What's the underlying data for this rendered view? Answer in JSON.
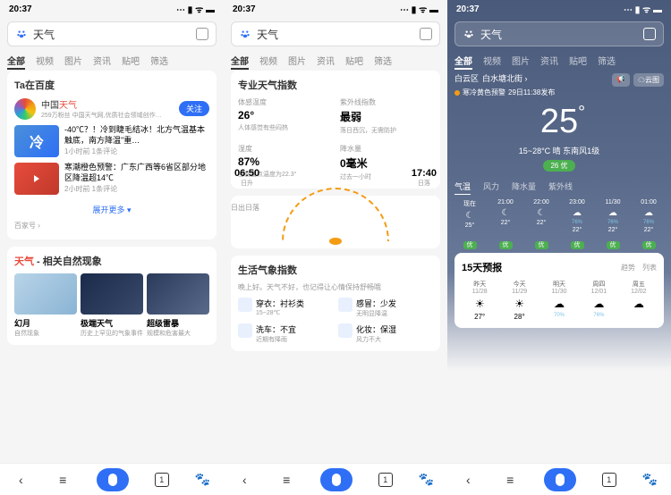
{
  "statusTime": "20:37",
  "searchText": "天气",
  "tabs": [
    "全部",
    "视频",
    "图片",
    "资讯",
    "贴吧",
    "筛选"
  ],
  "s1": {
    "taTitle": "Ta在百度",
    "brandName": "中国天气",
    "brandDesc": "259万粉丝 中国天气网,优质社会领域创作…",
    "followBtn": "关注",
    "news1Title": "-40℃？！冷到睫毛结冰！北方气温基本触底，南方降温\"重…",
    "news1Meta": "1小时前 1条评论",
    "coldChar": "冷",
    "news2Title": "寒潮橙色预警：广东广西等6省区部分地区降温超14℃",
    "news2Meta": "2小时前 1条评论",
    "expand": "展开更多 ▾",
    "source": "百家号 ›",
    "redTitle": "天气",
    "subTitle": " - 相关自然现象",
    "p1Name": "幻月",
    "p1Desc": "自然现象",
    "p2Name": "极端天气",
    "p2Desc": "历史上罕见的气象事件",
    "p3Name": "超级雷暴",
    "p3Desc": "规模和危害最大"
  },
  "s2": {
    "title1": "专业天气指数",
    "m1Label": "体感温度",
    "m1Val": "26°",
    "m1Desc": "人体感觉有些闷热",
    "m2Label": "紫外线指数",
    "m2Val": "最弱",
    "m2Desc": "落日西沉，无需防护",
    "m3Label": "湿度",
    "m3Val": "87%",
    "m3Desc": "当前露点温度为22.3°",
    "m4Label": "降水量",
    "m4Val": "0毫米",
    "m4Desc": "过去一小时",
    "sunTitle": "日出日落",
    "sunrise": "06:50",
    "sunriseL": "日升",
    "sunset": "17:40",
    "sunsetL": "日落",
    "title2": "生活气象指数",
    "lifeSub": "晚上好。天气不好，也记得让心情保持舒畅哦",
    "l1": "穿衣：衬衫类",
    "l1d": "15~28℃",
    "l2": "感冒：少发",
    "l2d": "无明显降温",
    "l3": "洗车：不宜",
    "l3d": "近期有降雨",
    "l4": "化妆：保湿",
    "l4d": "风力不大"
  },
  "s3": {
    "loc1": "白云区",
    "loc2": "白水塘北街 ›",
    "warnText": "寒冷黄色预警",
    "warnTime": "29日11:38发布",
    "rb1": "📢",
    "rb2": "☁云图",
    "bigTemp": "25",
    "tempSub": "15~28°C 晴 东南风1级",
    "aqi": "26 优",
    "subTabs": [
      "气温",
      "风力",
      "降水量",
      "紫外线"
    ],
    "hours": [
      {
        "t": "现在",
        "i": "☾",
        "p": "",
        "temp": "25°"
      },
      {
        "t": "21:00",
        "i": "☾",
        "p": "",
        "temp": "22°"
      },
      {
        "t": "22:00",
        "i": "☾",
        "p": "",
        "temp": "22°"
      },
      {
        "t": "23:00",
        "i": "☁",
        "p": "76%",
        "temp": "22°"
      },
      {
        "t": "11/30",
        "i": "☁",
        "p": "76%",
        "temp": "22°"
      },
      {
        "t": "01:00",
        "i": "☁",
        "p": "76%",
        "temp": "22°"
      }
    ],
    "quality": [
      "优",
      "优",
      "优",
      "优",
      "优",
      "优"
    ],
    "fcTitle": "15天预报",
    "fcTab1": "趋势",
    "fcTab2": "列表",
    "days": [
      {
        "n": "昨天",
        "d": "11/28",
        "i": "☀",
        "p": "",
        "t": "27°"
      },
      {
        "n": "今天",
        "d": "11/29",
        "i": "☀",
        "p": "",
        "t": "28°"
      },
      {
        "n": "明天",
        "d": "11/30",
        "i": "☁",
        "p": "70%",
        "t": ""
      },
      {
        "n": "周四",
        "d": "12/01",
        "i": "☁",
        "p": "76%",
        "t": ""
      },
      {
        "n": "周五",
        "d": "12/02",
        "i": "☁",
        "p": "",
        "t": ""
      }
    ]
  }
}
